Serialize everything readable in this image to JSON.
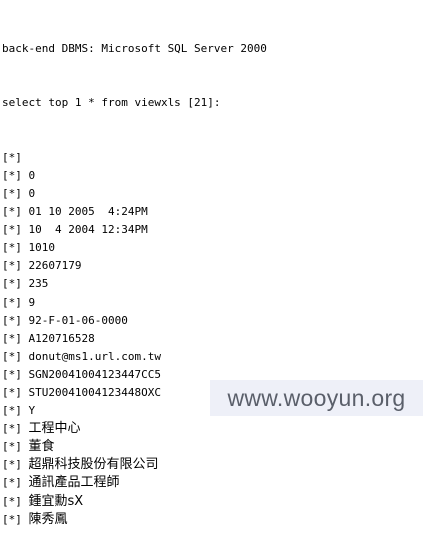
{
  "console": {
    "header": "back-end DBMS: Microsoft SQL Server 2000",
    "query": "select top 1 * from viewxls [21]:",
    "prefix": "[*]",
    "rows": [
      "",
      "0",
      "0",
      "01 10 2005  4:24PM",
      "10  4 2004 12:34PM",
      "1010",
      "22607179",
      "235",
      "9",
      "92-F-01-06-0000",
      "A120716528",
      "donut@ms1.url.com.tw",
      "SGN20041004123447CC5",
      "STU20041004123448OXC",
      "Y",
      "工程中心",
      "董食",
      "超鼎科技股份有限公司",
      "通訊產品工程師",
      "鍾宜勳sX",
      "陳秀鳳"
    ]
  },
  "watermark": {
    "text": "www.wooyun.org"
  }
}
